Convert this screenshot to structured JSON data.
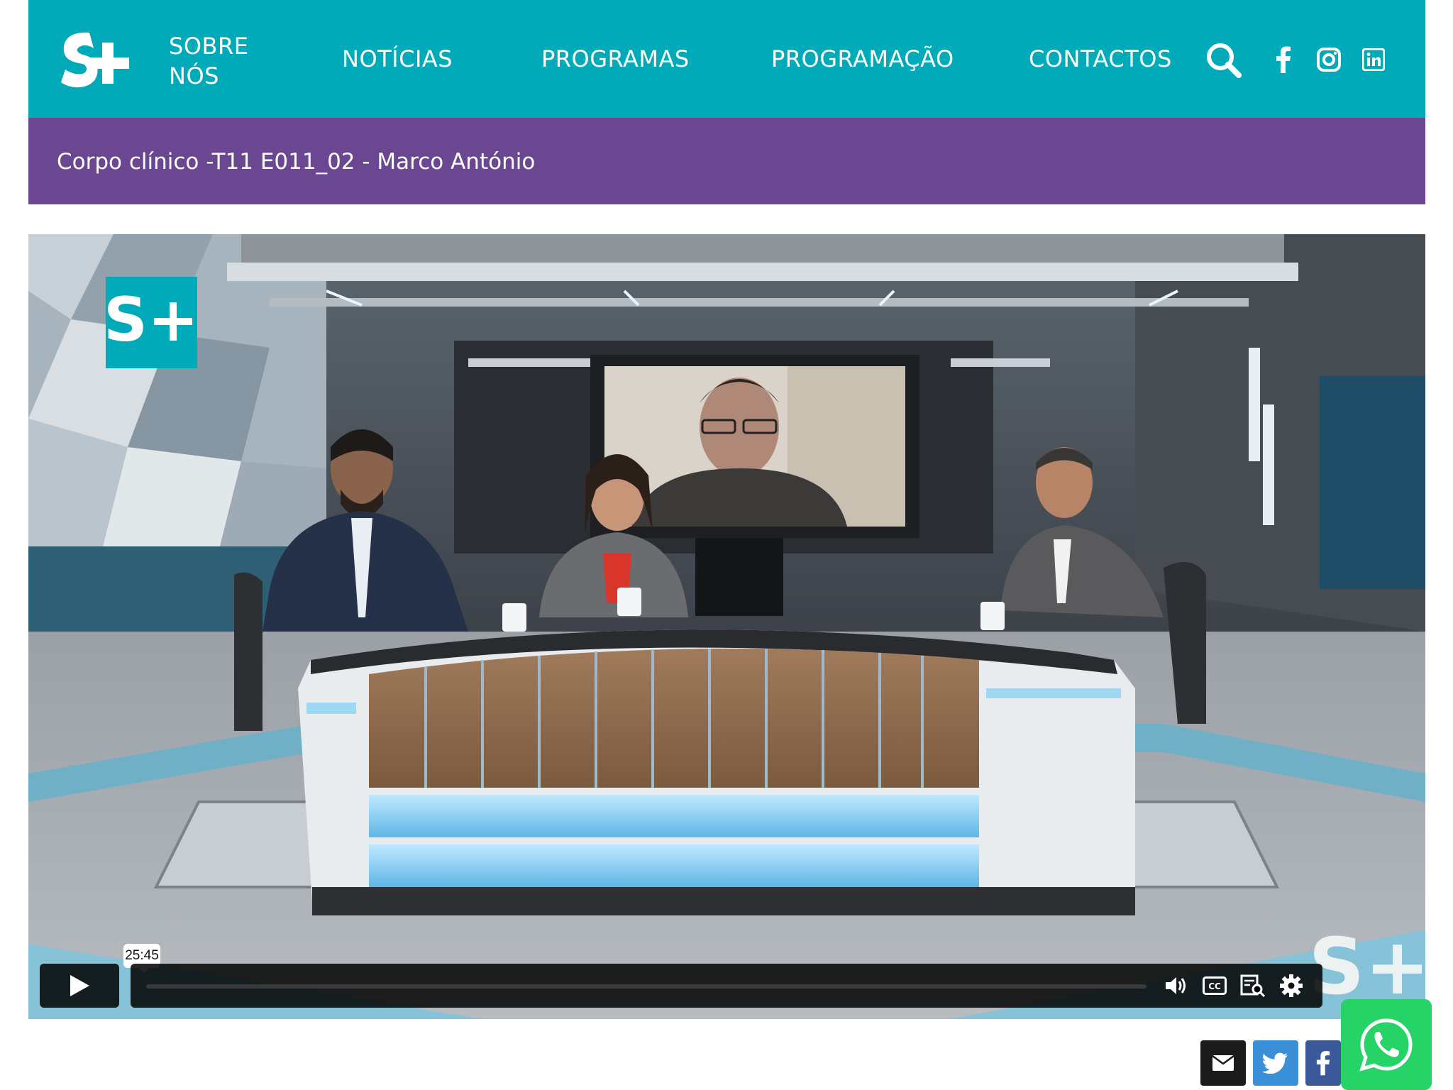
{
  "header": {
    "logo_alt": "S+",
    "nav": {
      "sobre_line1": "SOBRE",
      "sobre_line2": "NÓS",
      "noticias": "NOTÍCIAS",
      "programas": "PROGRAMAS",
      "programacao": "PROGRAMAÇÃO",
      "contactos": "CONTACTOS"
    },
    "icons": [
      "search-icon",
      "facebook-icon",
      "instagram-icon",
      "linkedin-icon"
    ]
  },
  "banner": {
    "title": "Corpo clínico -T11 E011_02 - Marco António"
  },
  "video": {
    "hover_time": "25:45",
    "progress": 0.0,
    "controls": [
      "play-icon",
      "volume-icon",
      "captions-icon",
      "transcript-icon",
      "settings-icon"
    ]
  },
  "share": [
    "email-icon",
    "twitter-icon",
    "facebook-icon",
    "whatsapp-icon"
  ],
  "colors": {
    "header": "#00aab8",
    "banner": "#6a4790",
    "whatsapp": "#25d366",
    "twitter": "#3a8fd9",
    "facebook": "#3b5998"
  }
}
